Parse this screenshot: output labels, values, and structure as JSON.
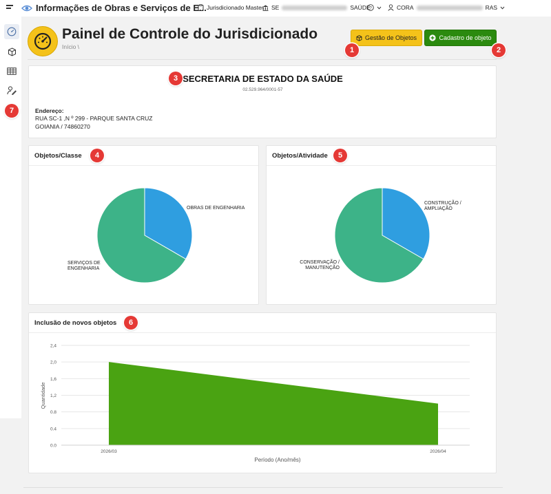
{
  "topbar": {
    "app_title": "Informações de Obras e Serviços de E...",
    "profile": "Jurisdicionado Master",
    "org_prefix": "SE",
    "org_suffix": "SAÚDE",
    "user_prefix": "CORA",
    "user_suffix": "RAS"
  },
  "header": {
    "title": "Painel de Controle do Jurisdicionado",
    "breadcrumb": "Início  \\",
    "btn_gestao": "Gestão de Objetos",
    "btn_cadastro": "Cadastro de objeto"
  },
  "org": {
    "name": "SECRETARIA DE ESTADO DA SAÚDE",
    "cnpj": "02.529.964/0001-57",
    "address_label": "Endereço:",
    "address_line1": "RUA SC-1 ,N º 299 - PARQUE SANTA CRUZ",
    "address_line2": "GOIANIA / 74860270"
  },
  "charts_titles": {
    "classe": "Objetos/Classe",
    "atividade": "Objetos/Atividade",
    "inclusao": "Inclusão de novos objetos"
  },
  "markers": [
    "1",
    "2",
    "3",
    "4",
    "5",
    "6",
    "7"
  ],
  "colors": {
    "blue": "#2f9ee0",
    "green": "#3db388",
    "area": "#4aa312",
    "yellow": "#f4c21a",
    "dark_green": "#2b8a0f",
    "marker_red": "#e53935"
  },
  "chart_data": [
    {
      "type": "pie",
      "title": "Objetos/Classe",
      "slices": [
        {
          "label": "OBRAS DE ENGENHARIA",
          "value": 1,
          "color": "#2f9ee0"
        },
        {
          "label": "SERVIÇOS DE ENGENHARIA",
          "value": 2,
          "color": "#3db388"
        }
      ]
    },
    {
      "type": "pie",
      "title": "Objetos/Atividade",
      "slices": [
        {
          "label": "CONSTRUÇÃO / AMPLIAÇÃO",
          "value": 1,
          "color": "#2f9ee0"
        },
        {
          "label": "CONSERVAÇÃO / MANUTENÇÃO",
          "value": 2,
          "color": "#3db388"
        }
      ]
    },
    {
      "type": "area",
      "title": "Inclusão de novos objetos",
      "xlabel": "Período (Ano/mês)",
      "ylabel": "Quantidade",
      "x": [
        "2026/03",
        "2026/04"
      ],
      "values": [
        2,
        1
      ],
      "ylim": [
        0,
        2.4
      ],
      "yticks": [
        "0.0",
        "0.4",
        "0.8",
        "1,2",
        "1,6",
        "2,0",
        "2,4"
      ],
      "grid": true
    }
  ]
}
